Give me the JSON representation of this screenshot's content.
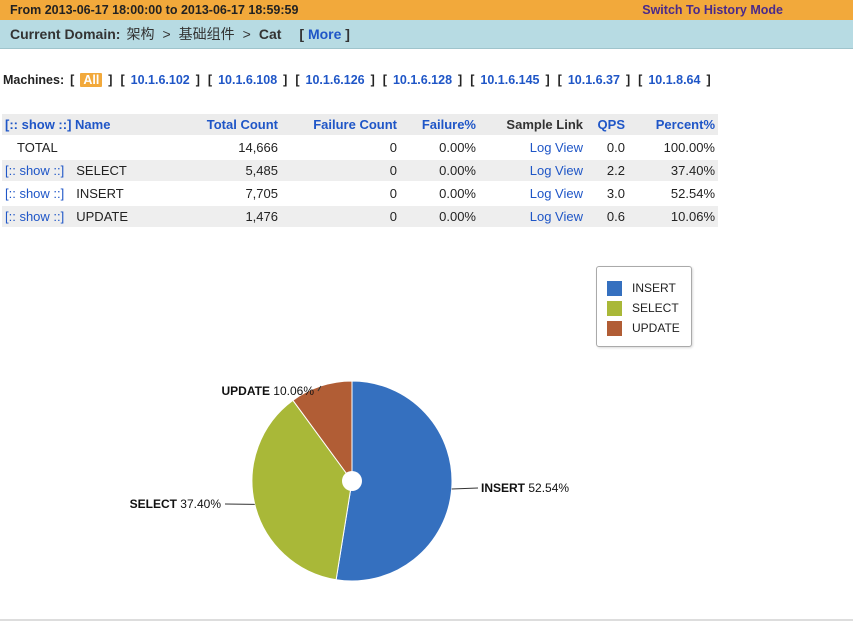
{
  "topbar": {
    "from_label": "From",
    "start": "2013-06-17 18:00:00",
    "to_label": "to",
    "end": "2013-06-17 18:59:59",
    "history_link": "Switch To History Mode"
  },
  "domainbar": {
    "label": "Current Domain:",
    "domain": "架构",
    "sep1": ">",
    "group": "基础组件",
    "sep2": ">",
    "current": "Cat",
    "more_open": "[",
    "more": "More",
    "more_close": "]"
  },
  "machines": {
    "label": "Machines:",
    "items": [
      {
        "label": "All",
        "active": true
      },
      {
        "label": "10.1.6.102",
        "active": false
      },
      {
        "label": "10.1.6.108",
        "active": false
      },
      {
        "label": "10.1.6.126",
        "active": false
      },
      {
        "label": "10.1.6.128",
        "active": false
      },
      {
        "label": "10.1.6.145",
        "active": false
      },
      {
        "label": "10.1.6.37",
        "active": false
      },
      {
        "label": "10.1.8.64",
        "active": false
      }
    ]
  },
  "table": {
    "headers": {
      "show": "[:: show ::]",
      "name": "Name",
      "total": "Total Count",
      "failure_count": "Failure Count",
      "failure_pct": "Failure%",
      "sample": "Sample Link",
      "qps": "QPS",
      "percent": "Percent%"
    },
    "rows": [
      {
        "show": "",
        "name": "TOTAL",
        "total": "14,666",
        "failure_count": "0",
        "failure_pct": "0.00%",
        "sample": "Log View",
        "qps": "0.0",
        "percent": "100.00%"
      },
      {
        "show": "[:: show ::]",
        "name": "SELECT",
        "total": "5,485",
        "failure_count": "0",
        "failure_pct": "0.00%",
        "sample": "Log View",
        "qps": "2.2",
        "percent": "37.40%"
      },
      {
        "show": "[:: show ::]",
        "name": "INSERT",
        "total": "7,705",
        "failure_count": "0",
        "failure_pct": "0.00%",
        "sample": "Log View",
        "qps": "3.0",
        "percent": "52.54%"
      },
      {
        "show": "[:: show ::]",
        "name": "UPDATE",
        "total": "1,476",
        "failure_count": "0",
        "failure_pct": "0.00%",
        "sample": "Log View",
        "qps": "0.6",
        "percent": "10.06%"
      }
    ]
  },
  "colors": {
    "topbar": "#f2a93b",
    "domainbar": "#b7dbe3",
    "link": "#1f56c7",
    "insert": "#3570bf",
    "select": "#a9b838",
    "update": "#b15d35"
  },
  "chart_data": {
    "type": "pie",
    "legend_position": "top-right",
    "slices": [
      {
        "name": "INSERT",
        "value": 52.54,
        "label": "52.54%",
        "color": "#3570bf"
      },
      {
        "name": "SELECT",
        "value": 37.4,
        "label": "37.40%",
        "color": "#a9b838"
      },
      {
        "name": "UPDATE",
        "value": 10.06,
        "label": "10.06%",
        "color": "#b15d35"
      }
    ]
  }
}
